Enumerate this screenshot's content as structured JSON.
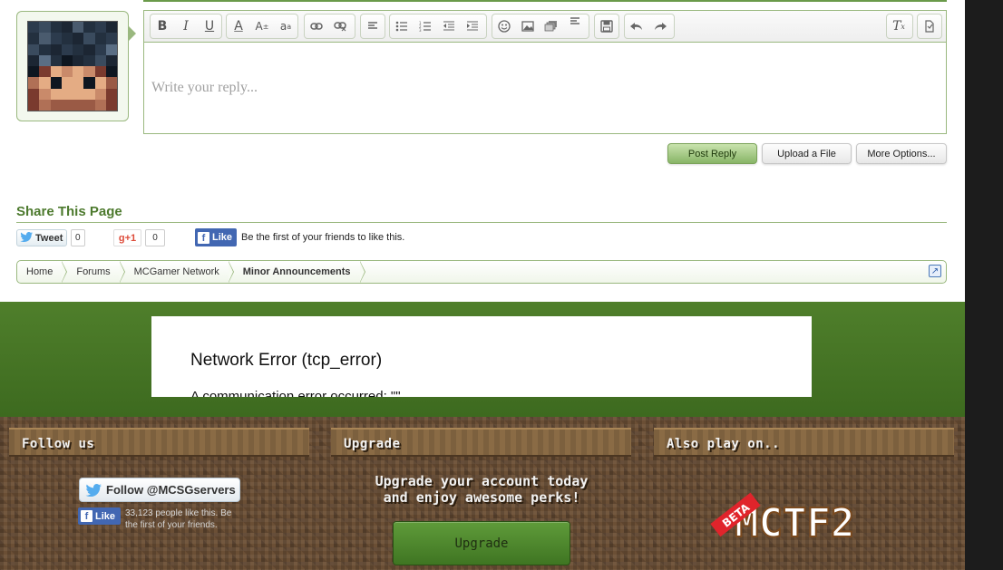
{
  "editor": {
    "placeholder": "Write your reply...",
    "toolbar_icons": [
      "bold-icon",
      "italic-icon",
      "underline-icon",
      "font-color-icon",
      "font-size-icon",
      "font-family-icon",
      "link-icon",
      "unlink-icon",
      "align-icon",
      "bullet-list-icon",
      "numbered-list-icon",
      "outdent-icon",
      "indent-icon",
      "smiley-icon",
      "image-icon",
      "media-icon",
      "more-align-icon",
      "save-draft-icon",
      "undo-icon",
      "redo-icon",
      "remove-format-icon",
      "toggle-bbcode-icon"
    ]
  },
  "actions": {
    "post_reply": "Post Reply",
    "upload_file": "Upload a File",
    "more_options": "More Options..."
  },
  "share": {
    "title": "Share This Page",
    "tweet_label": "Tweet",
    "tweet_count": "0",
    "gplus_label": "+1",
    "gplus_count": "0",
    "fb_like_label": "Like",
    "fb_text": "Be the first of your friends to like this."
  },
  "breadcrumb": {
    "items": [
      "Home",
      "Forums",
      "MCGamer Network",
      "Minor Announcements"
    ]
  },
  "error": {
    "title": "Network Error (tcp_error)",
    "text": "A communication error occurred: \"\""
  },
  "footer": {
    "follow_title": "Follow us",
    "upgrade_title": "Upgrade",
    "also_title": "Also play on..",
    "follow_button": "Follow @MCSGservers",
    "fb_like_label": "Like",
    "fb_footer_text": "33,123 people like this. Be the first of your friends.",
    "upgrade_line1": "Upgrade your account today",
    "upgrade_line2": "and enjoy awesome perks!",
    "upgrade_button": "Upgrade",
    "beta_label": "BETA",
    "mctf2_label": "MCTF2"
  },
  "colors": {
    "accent_green": "#4d7a2e",
    "border_green": "#9ab87f",
    "facebook_blue": "#4267b2",
    "band_green": "#4f7f2b"
  }
}
